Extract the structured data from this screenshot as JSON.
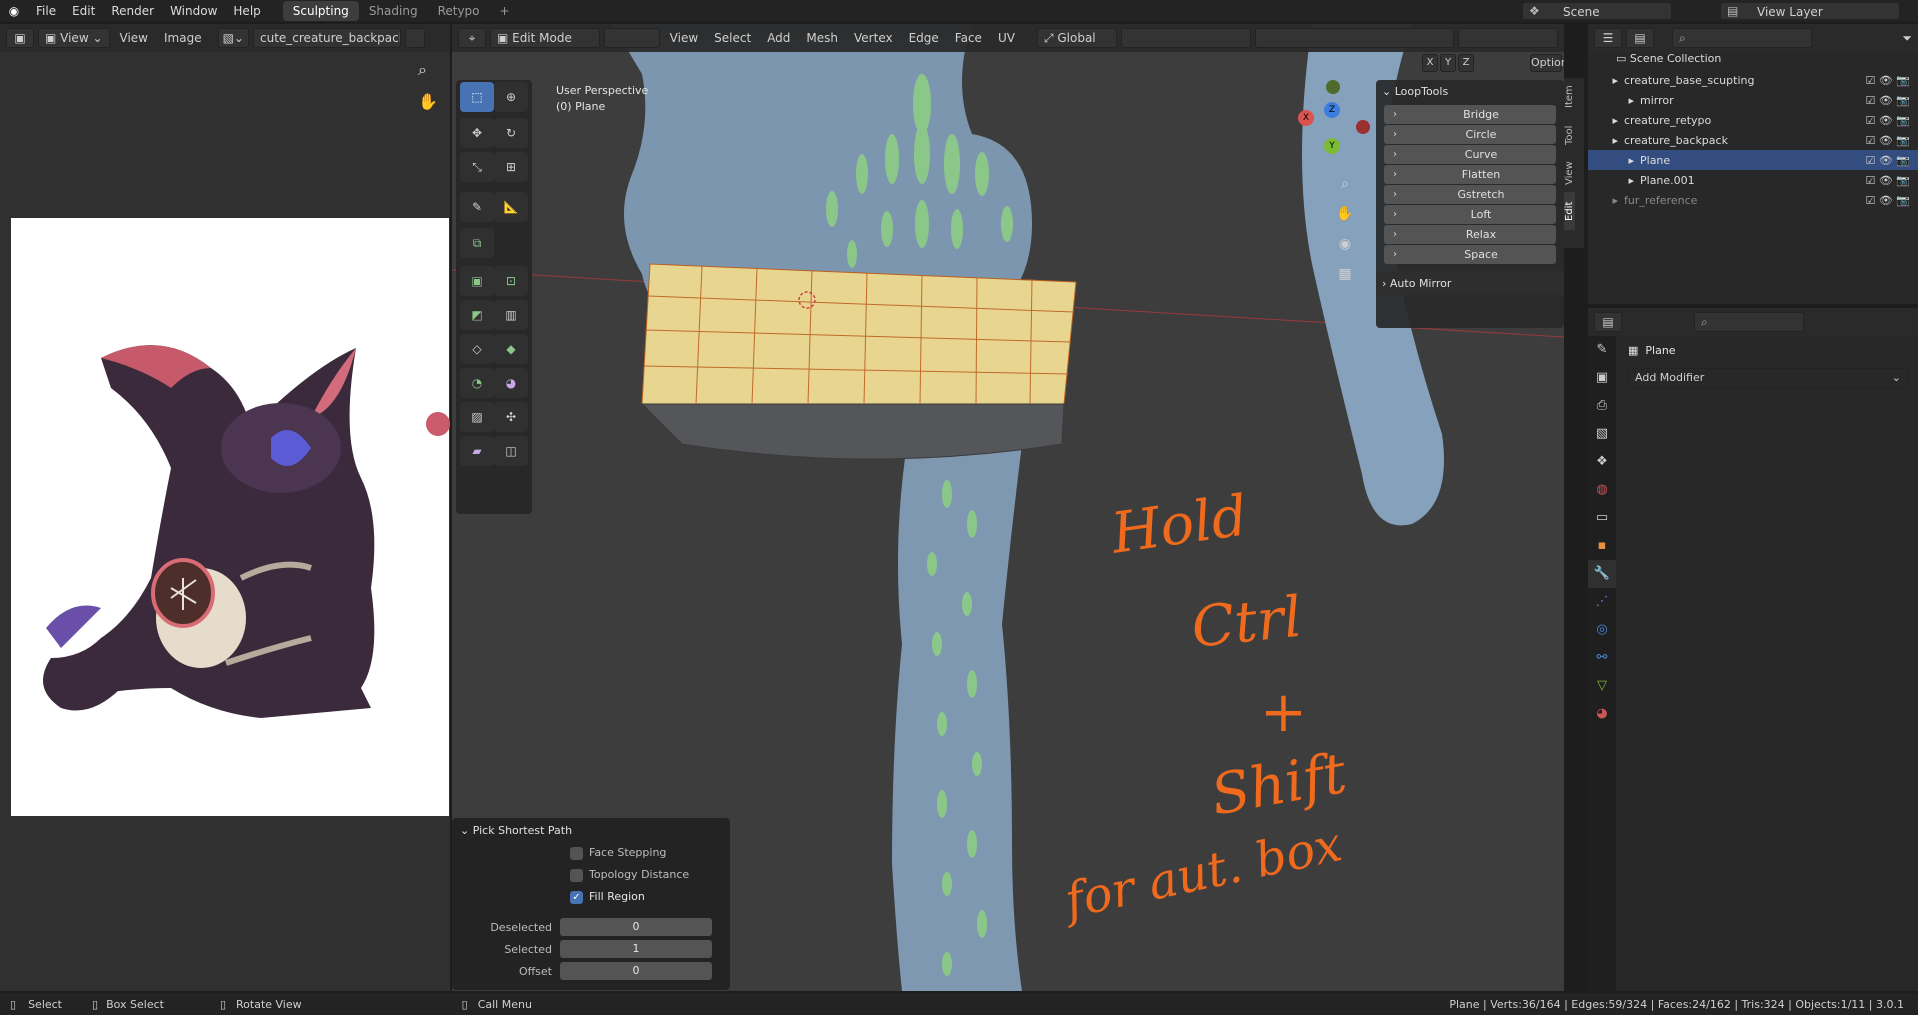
{
  "topbar": {
    "menus": [
      "File",
      "Edit",
      "Render",
      "Window",
      "Help"
    ],
    "workspaces": [
      "Sculpting",
      "Shading",
      "Retypo"
    ],
    "active_workspace": "Sculpting",
    "add_tab": "+",
    "scene": "Scene",
    "view_layer": "View Layer"
  },
  "image_editor": {
    "view_menu": "View",
    "view2": "View",
    "image_menu": "Image",
    "filename": "cute_creature_backpack.jpg"
  },
  "viewport": {
    "mode": "Edit Mode",
    "menus": [
      "View",
      "Select",
      "Add",
      "Mesh",
      "Vertex",
      "Edge",
      "Face",
      "UV"
    ],
    "orientation": "Global",
    "axes": [
      "X",
      "Y",
      "Z"
    ],
    "options": "Options",
    "info_line1": "User Perspective",
    "info_line2": "(0) Plane",
    "side_tabs": [
      "Item",
      "Tool",
      "View",
      "Edit"
    ]
  },
  "looptools": {
    "title": "LoopTools",
    "items": [
      "Bridge",
      "Circle",
      "Curve",
      "Flatten",
      "Gstretch",
      "Loft",
      "Relax",
      "Space"
    ],
    "auto_mirror": "Auto Mirror"
  },
  "operator_panel": {
    "title": "Pick Shortest Path",
    "checkboxes": [
      {
        "label": "Face Stepping",
        "checked": false
      },
      {
        "label": "Topology Distance",
        "checked": false
      },
      {
        "label": "Fill Region",
        "checked": true
      }
    ],
    "fields": [
      {
        "label": "Deselected",
        "value": "0"
      },
      {
        "label": "Selected",
        "value": "1"
      },
      {
        "label": "Offset",
        "value": "0"
      }
    ]
  },
  "annotation": {
    "line1": "Hold",
    "line2": "Ctrl",
    "line3": "+",
    "line4": "Shift",
    "line5": "for aut. box"
  },
  "outliner": {
    "root": "Scene Collection",
    "rows": [
      {
        "label": "creature_base_scupting",
        "indent": 1
      },
      {
        "label": "mirror",
        "indent": 2
      },
      {
        "label": "creature_retypo",
        "indent": 1
      },
      {
        "label": "creature_backpack",
        "indent": 1
      },
      {
        "label": "Plane",
        "indent": 2,
        "selected": true
      },
      {
        "label": "Plane.001",
        "indent": 2
      },
      {
        "label": "fur_reference",
        "indent": 1,
        "dim": true
      }
    ]
  },
  "properties": {
    "object_name": "Plane",
    "add_modifier": "Add Modifier"
  },
  "status": {
    "select": "Select",
    "box_select": "Box Select",
    "rotate_view": "Rotate View",
    "call_menu": "Call Menu",
    "stats": "Plane | Verts:36/164 | Edges:59/324 | Faces:24/162 | Tris:324 | Objects:1/11 | 3.0.1"
  },
  "colors": {
    "accent": "#4772b3",
    "mesh_blue": "#7e96ae",
    "mesh_green": "#8cc78a",
    "selection": "#e8d590",
    "annotation": "#f06a1e",
    "axis_x": "#d9534f",
    "axis_y": "#7cbb34",
    "axis_z": "#3e7de0"
  }
}
